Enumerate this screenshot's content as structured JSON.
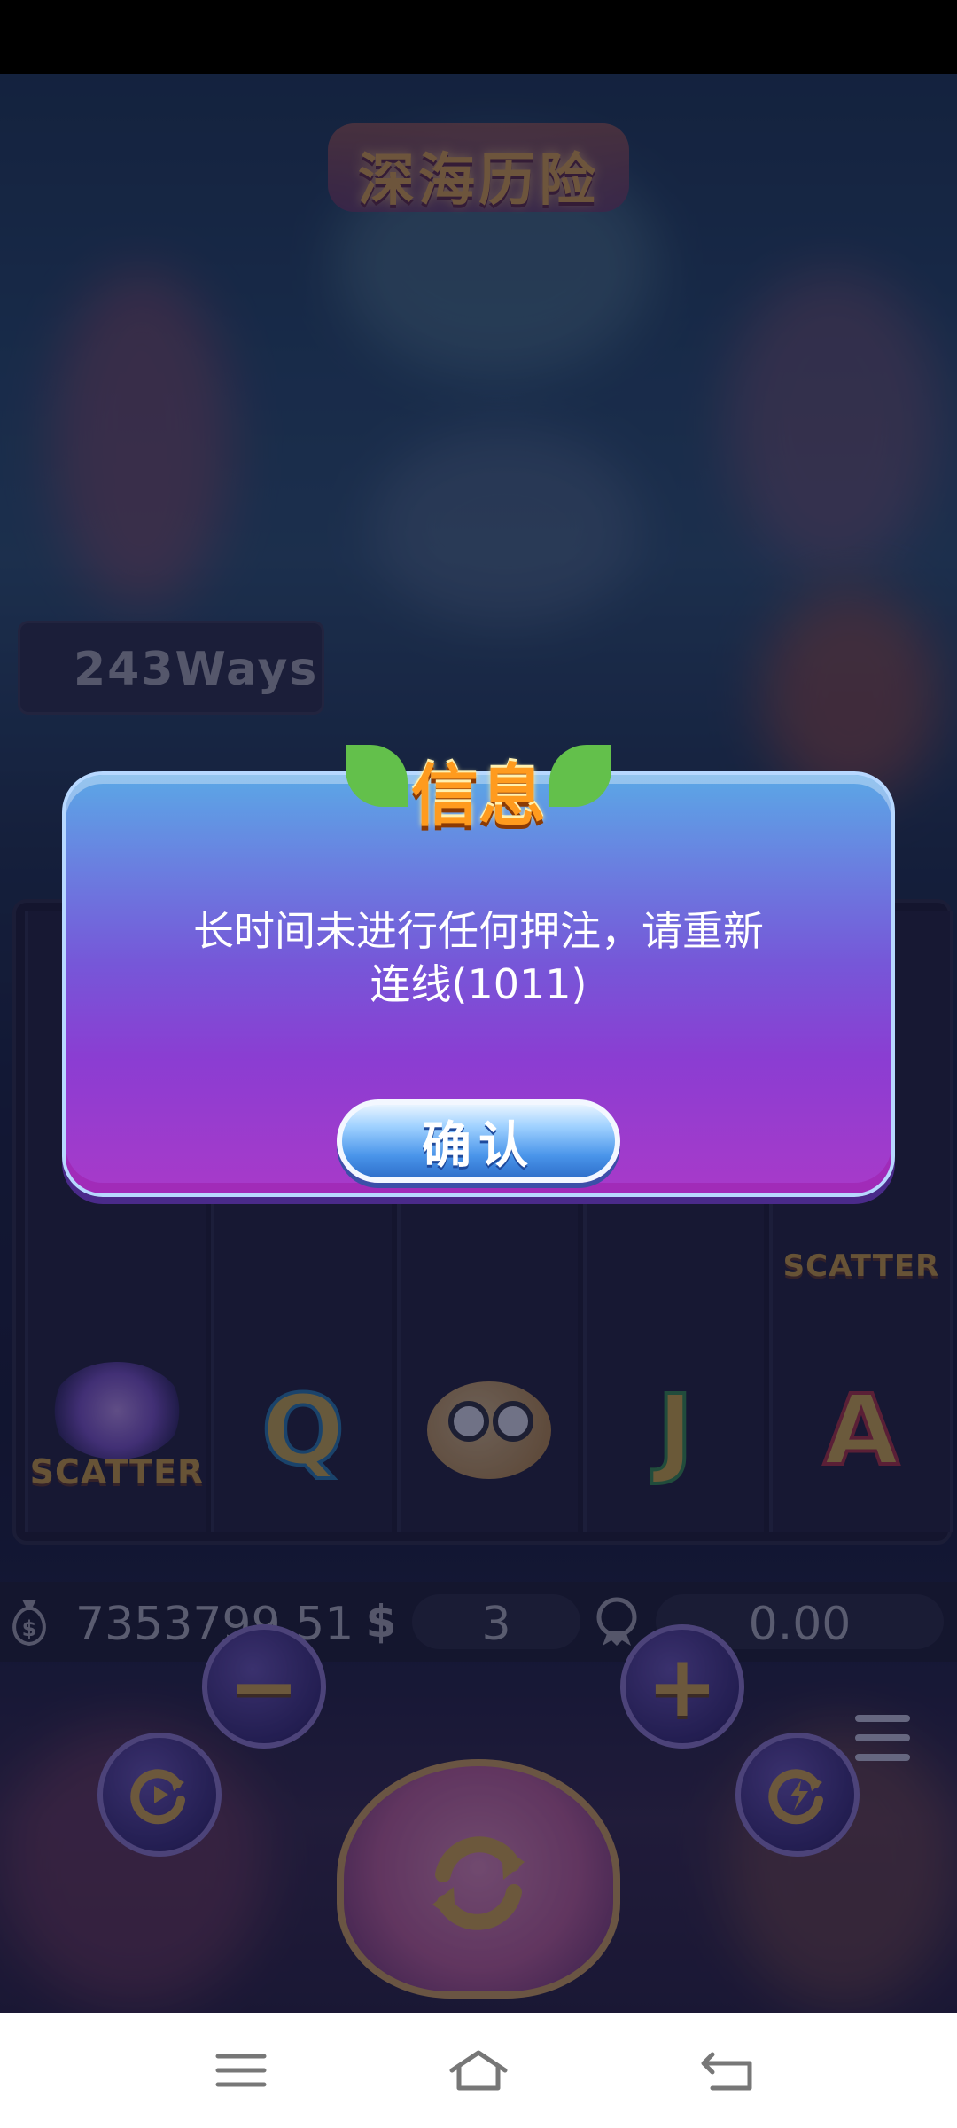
{
  "game": {
    "title": "深海历险",
    "ways_label": "243Ways"
  },
  "reels": {
    "bottom_row": [
      "SCATTER",
      "Q",
      "fish",
      "J",
      "A"
    ],
    "scatter_label": "SCATTER"
  },
  "balance_bar": {
    "balance": "7353799.51",
    "bet": "3",
    "win": "0.00",
    "balance_icon": "money-bag-icon",
    "bet_icon": "dollar-icon",
    "win_icon": "medal-icon"
  },
  "controls": {
    "minus_label": "−",
    "plus_label": "+",
    "spin_icon": "refresh-icon"
  },
  "dialog": {
    "title": "信息",
    "message_line1": "长时间未进行任何押注，请重新",
    "message_line2": "连线(1011)",
    "confirm_label": "确认"
  },
  "colors": {
    "dialog_top": "#5ba7e6",
    "dialog_bottom": "#a83ac9",
    "title_orange": "#ff9b1e",
    "confirm_blue": "#4a95ea",
    "gold": "#f4c14a"
  }
}
